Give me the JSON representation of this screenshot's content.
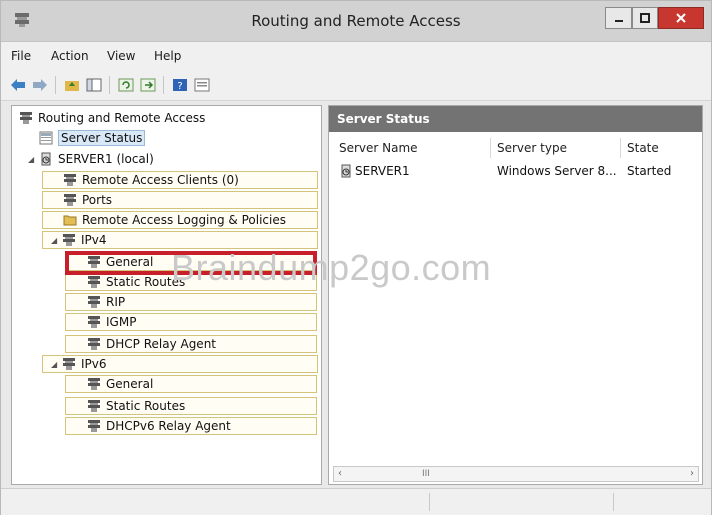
{
  "window": {
    "title": "Routing and Remote Access"
  },
  "menu": {
    "file": "File",
    "action": "Action",
    "view": "View",
    "help": "Help"
  },
  "tree": {
    "root": "Routing and Remote Access",
    "server_status": "Server Status",
    "server": "SERVER1 (local)",
    "remote_access_clients": "Remote Access Clients (0)",
    "ports": "Ports",
    "logging": "Remote Access Logging & Policies",
    "ipv4": {
      "label": "IPv4",
      "children": [
        "General",
        "Static Routes",
        "RIP",
        "IGMP",
        "DHCP Relay Agent"
      ]
    },
    "ipv6": {
      "label": "IPv6",
      "children": [
        "General",
        "Static Routes",
        "DHCPv6 Relay Agent"
      ]
    }
  },
  "details": {
    "header": "Server Status",
    "columns": [
      "Server Name",
      "Server type",
      "State"
    ],
    "rows": [
      {
        "name": "SERVER1",
        "type": "Windows Server 8...",
        "state": "Started"
      }
    ]
  },
  "watermark": "Braindump2go.com",
  "scrollbar": {
    "thumb": "III"
  },
  "colors": {
    "highlight": "#c8202a",
    "header_bg": "#737373",
    "tree_box": "#d4c47a"
  }
}
